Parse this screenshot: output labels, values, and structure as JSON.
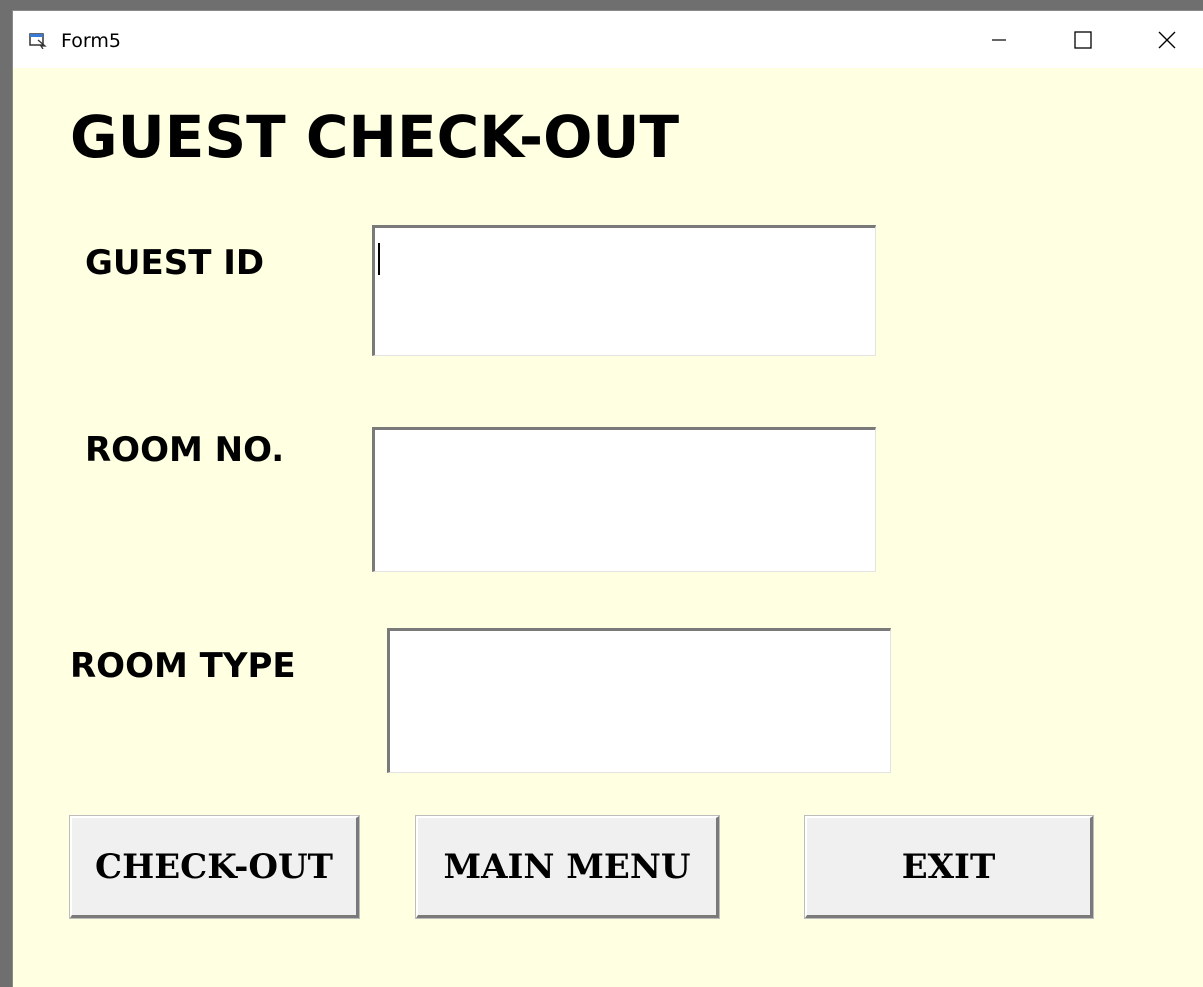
{
  "window": {
    "title": "Form5",
    "icon": "form-app-icon",
    "controls": {
      "minimize": "minimize-icon",
      "maximize": "maximize-icon",
      "close": "close-icon"
    }
  },
  "form": {
    "heading": "GUEST CHECK-OUT",
    "fields": {
      "guest_id": {
        "label": "GUEST ID",
        "value": ""
      },
      "room_no": {
        "label": "ROOM NO.",
        "value": ""
      },
      "room_type": {
        "label": "ROOM TYPE",
        "value": ""
      }
    },
    "buttons": {
      "checkout": "CHECK-OUT",
      "main_menu": "MAIN MENU",
      "exit": "EXIT"
    }
  },
  "colors": {
    "form_background": "#ffffe1",
    "titlebar": "#ffffff",
    "button_face": "#f0f0f0"
  }
}
